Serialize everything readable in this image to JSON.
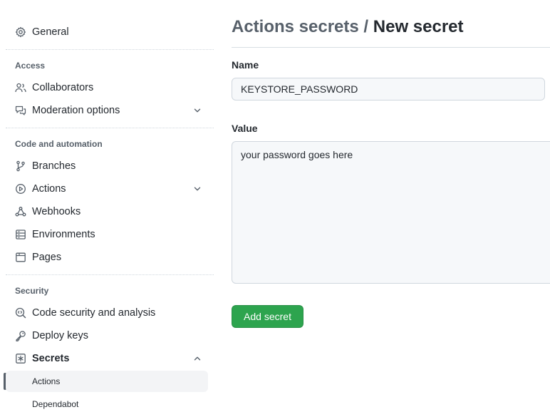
{
  "sidebar": {
    "general": "General",
    "sections": {
      "access": "Access",
      "code_automation": "Code and automation",
      "security": "Security"
    },
    "items": {
      "collaborators": "Collaborators",
      "moderation": "Moderation options",
      "branches": "Branches",
      "actions": "Actions",
      "webhooks": "Webhooks",
      "environments": "Environments",
      "pages": "Pages",
      "code_security": "Code security and analysis",
      "deploy_keys": "Deploy keys",
      "secrets": "Secrets"
    },
    "secrets_sub": {
      "actions": "Actions",
      "dependabot": "Dependabot"
    }
  },
  "main": {
    "breadcrumb": "Actions secrets",
    "separator": "/",
    "title": "New secret",
    "name_label": "Name",
    "name_value": "KEYSTORE_PASSWORD",
    "value_label": "Value",
    "value_value": "your password goes here",
    "submit_label": "Add secret"
  },
  "colors": {
    "primary_button": "#2da44e",
    "active_indicator": "#57606a"
  }
}
